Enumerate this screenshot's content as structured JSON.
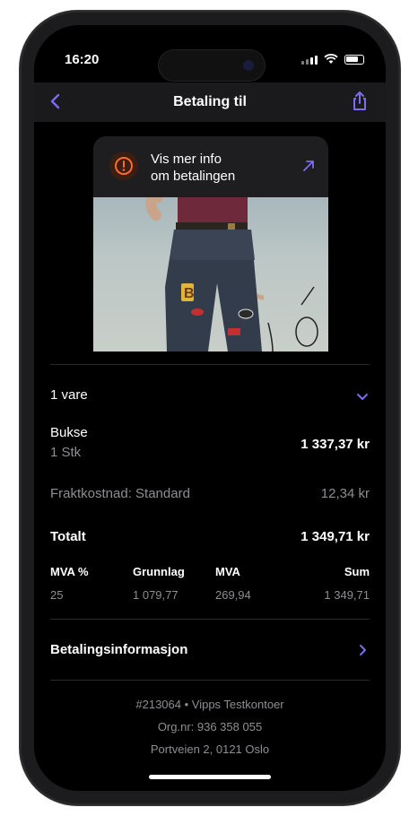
{
  "status": {
    "time": "16:20"
  },
  "nav": {
    "title": "Betaling til"
  },
  "info_card": {
    "line1": "Vis mer info",
    "line2": "om betalingen"
  },
  "order": {
    "count_label": "1 vare",
    "item_name": "Bukse",
    "item_qty": "1 Stk",
    "item_price": "1 337,37 kr",
    "shipping_label": "Fraktkostnad: Standard",
    "shipping_price": "12,34 kr",
    "total_label": "Totalt",
    "total_price": "1 349,71 kr"
  },
  "vat": {
    "headers": [
      "MVA %",
      "Grunnlag",
      "MVA",
      "Sum"
    ],
    "values": [
      "25",
      "1 079,77",
      "269,94",
      "1 349,71"
    ]
  },
  "payment_info": {
    "label": "Betalingsinformasjon"
  },
  "merchant": {
    "line1": "#213064 • Vipps Testkontoer",
    "line2": "Org.nr: 936 358 055",
    "line3": "Portveien 2, 0121 Oslo"
  },
  "colors": {
    "accent": "#7b6cf0",
    "info_orange": "#ff6a2b",
    "background": "#000000"
  },
  "icons": [
    "back-chevron-icon",
    "share-icon",
    "info-icon",
    "arrow-up-right-icon",
    "chevron-down-icon",
    "chevron-right-icon"
  ]
}
